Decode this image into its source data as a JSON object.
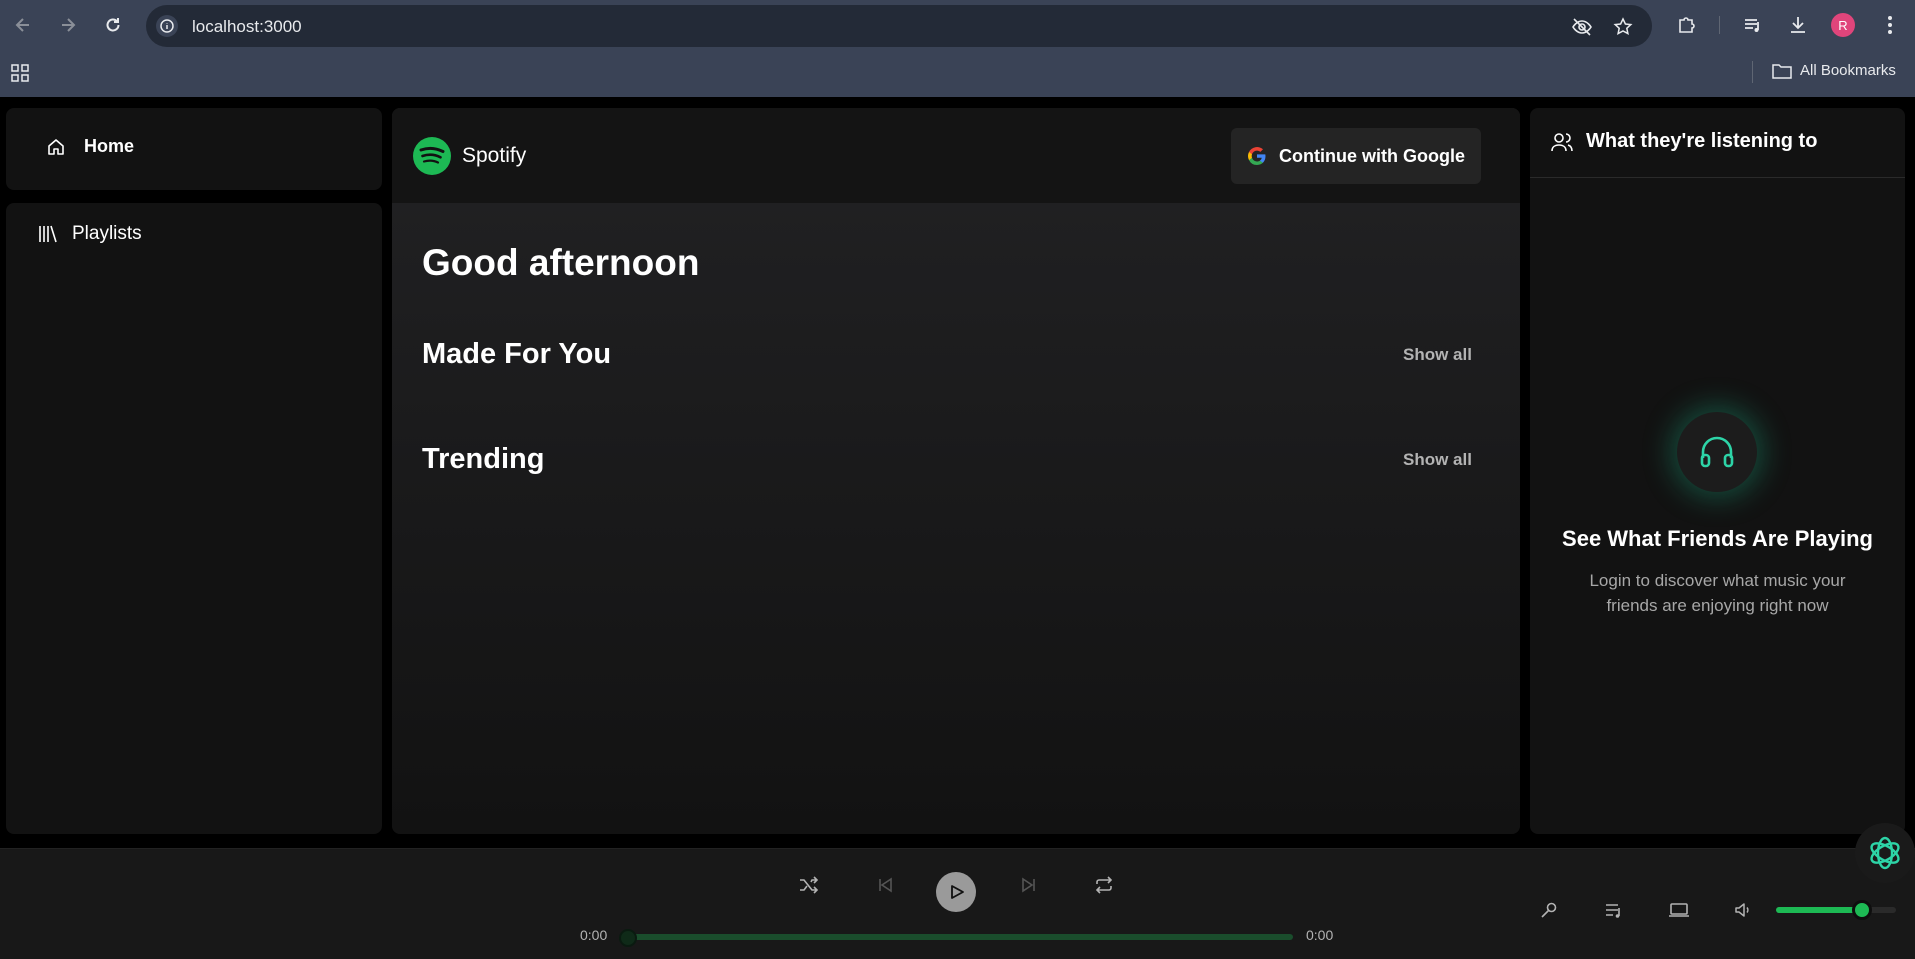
{
  "browser": {
    "url": "localhost:3000",
    "avatar_initial": "R",
    "all_bookmarks": "All Bookmarks"
  },
  "sidebar": {
    "home_label": "Home",
    "playlists_label": "Playlists"
  },
  "header": {
    "brand": "Spotify",
    "google_button": "Continue with Google"
  },
  "main": {
    "greeting": "Good afternoon",
    "sections": [
      {
        "title": "Made For You",
        "show_all": "Show all"
      },
      {
        "title": "Trending",
        "show_all": "Show all"
      }
    ]
  },
  "friends": {
    "title": "What they're listening to",
    "heading": "See What Friends Are Playing",
    "description": "Login to discover what music your friends are enjoying right now"
  },
  "player": {
    "current_time": "0:00",
    "duration": "0:00",
    "progress": 0,
    "volume": 0.72
  },
  "colors": {
    "accent": "#1db954",
    "teal": "#2dd4a7"
  }
}
